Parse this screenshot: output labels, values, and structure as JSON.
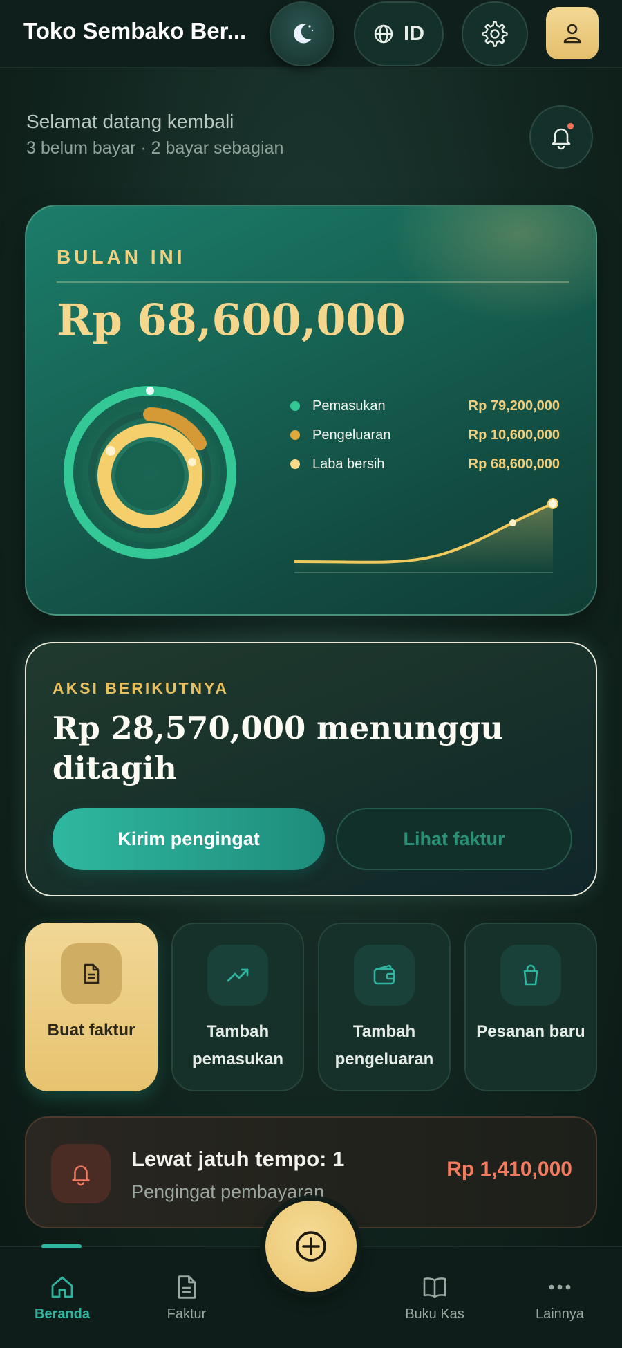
{
  "header": {
    "title": "Toko Sembako Ber...",
    "language": "ID",
    "icons": {
      "theme": "moon-icon",
      "language": "globe-icon",
      "settings": "gear-icon",
      "profile": "user-icon"
    }
  },
  "welcome": {
    "title": "Selamat datang kembali",
    "subtitle": "3 belum bayar · 2 bayar sebagian"
  },
  "summary": {
    "label": "BULAN INI",
    "amount": "Rp 68,600,000",
    "legend": [
      {
        "name": "Pemasukan",
        "value": "Rp 79,200,000",
        "color": "#34c896"
      },
      {
        "name": "Pengeluaran",
        "value": "Rp 10,600,000",
        "color": "#e0a93c"
      },
      {
        "name": "Laba bersih",
        "value": "Rp 68,600,000",
        "color": "#f6d98a"
      }
    ]
  },
  "next_action": {
    "label": "AKSI BERIKUTNYA",
    "title": "Rp 28,570,000 menunggu ditagih",
    "primary_button": "Kirim pengingat",
    "secondary_button": "Lihat faktur"
  },
  "quick_actions": [
    {
      "label": "Buat faktur",
      "icon": "document-icon"
    },
    {
      "label": "Tambah pemasukan",
      "icon": "trending-up-icon"
    },
    {
      "label": "Tambah pengeluaran",
      "icon": "wallet-icon"
    },
    {
      "label": "Pesanan baru",
      "icon": "shopping-bag-icon"
    }
  ],
  "overdue": {
    "title": "Lewat jatuh tempo: 1",
    "subtitle": "Pengingat pembayaran",
    "amount": "Rp 1,410,000",
    "icon": "bell-icon"
  },
  "nav": {
    "items": [
      {
        "label": "Beranda",
        "icon": "home-icon",
        "active": true
      },
      {
        "label": "Faktur",
        "icon": "document-icon",
        "active": false
      },
      {
        "label": "Buku Kas",
        "icon": "book-icon",
        "active": false
      },
      {
        "label": "Lainnya",
        "icon": "more-icon",
        "active": false
      }
    ],
    "fab_icon": "plus-circle-icon"
  },
  "colors": {
    "accent_teal": "#2fb59f",
    "accent_gold": "#f0cf7f",
    "danger": "#f27a5e"
  }
}
